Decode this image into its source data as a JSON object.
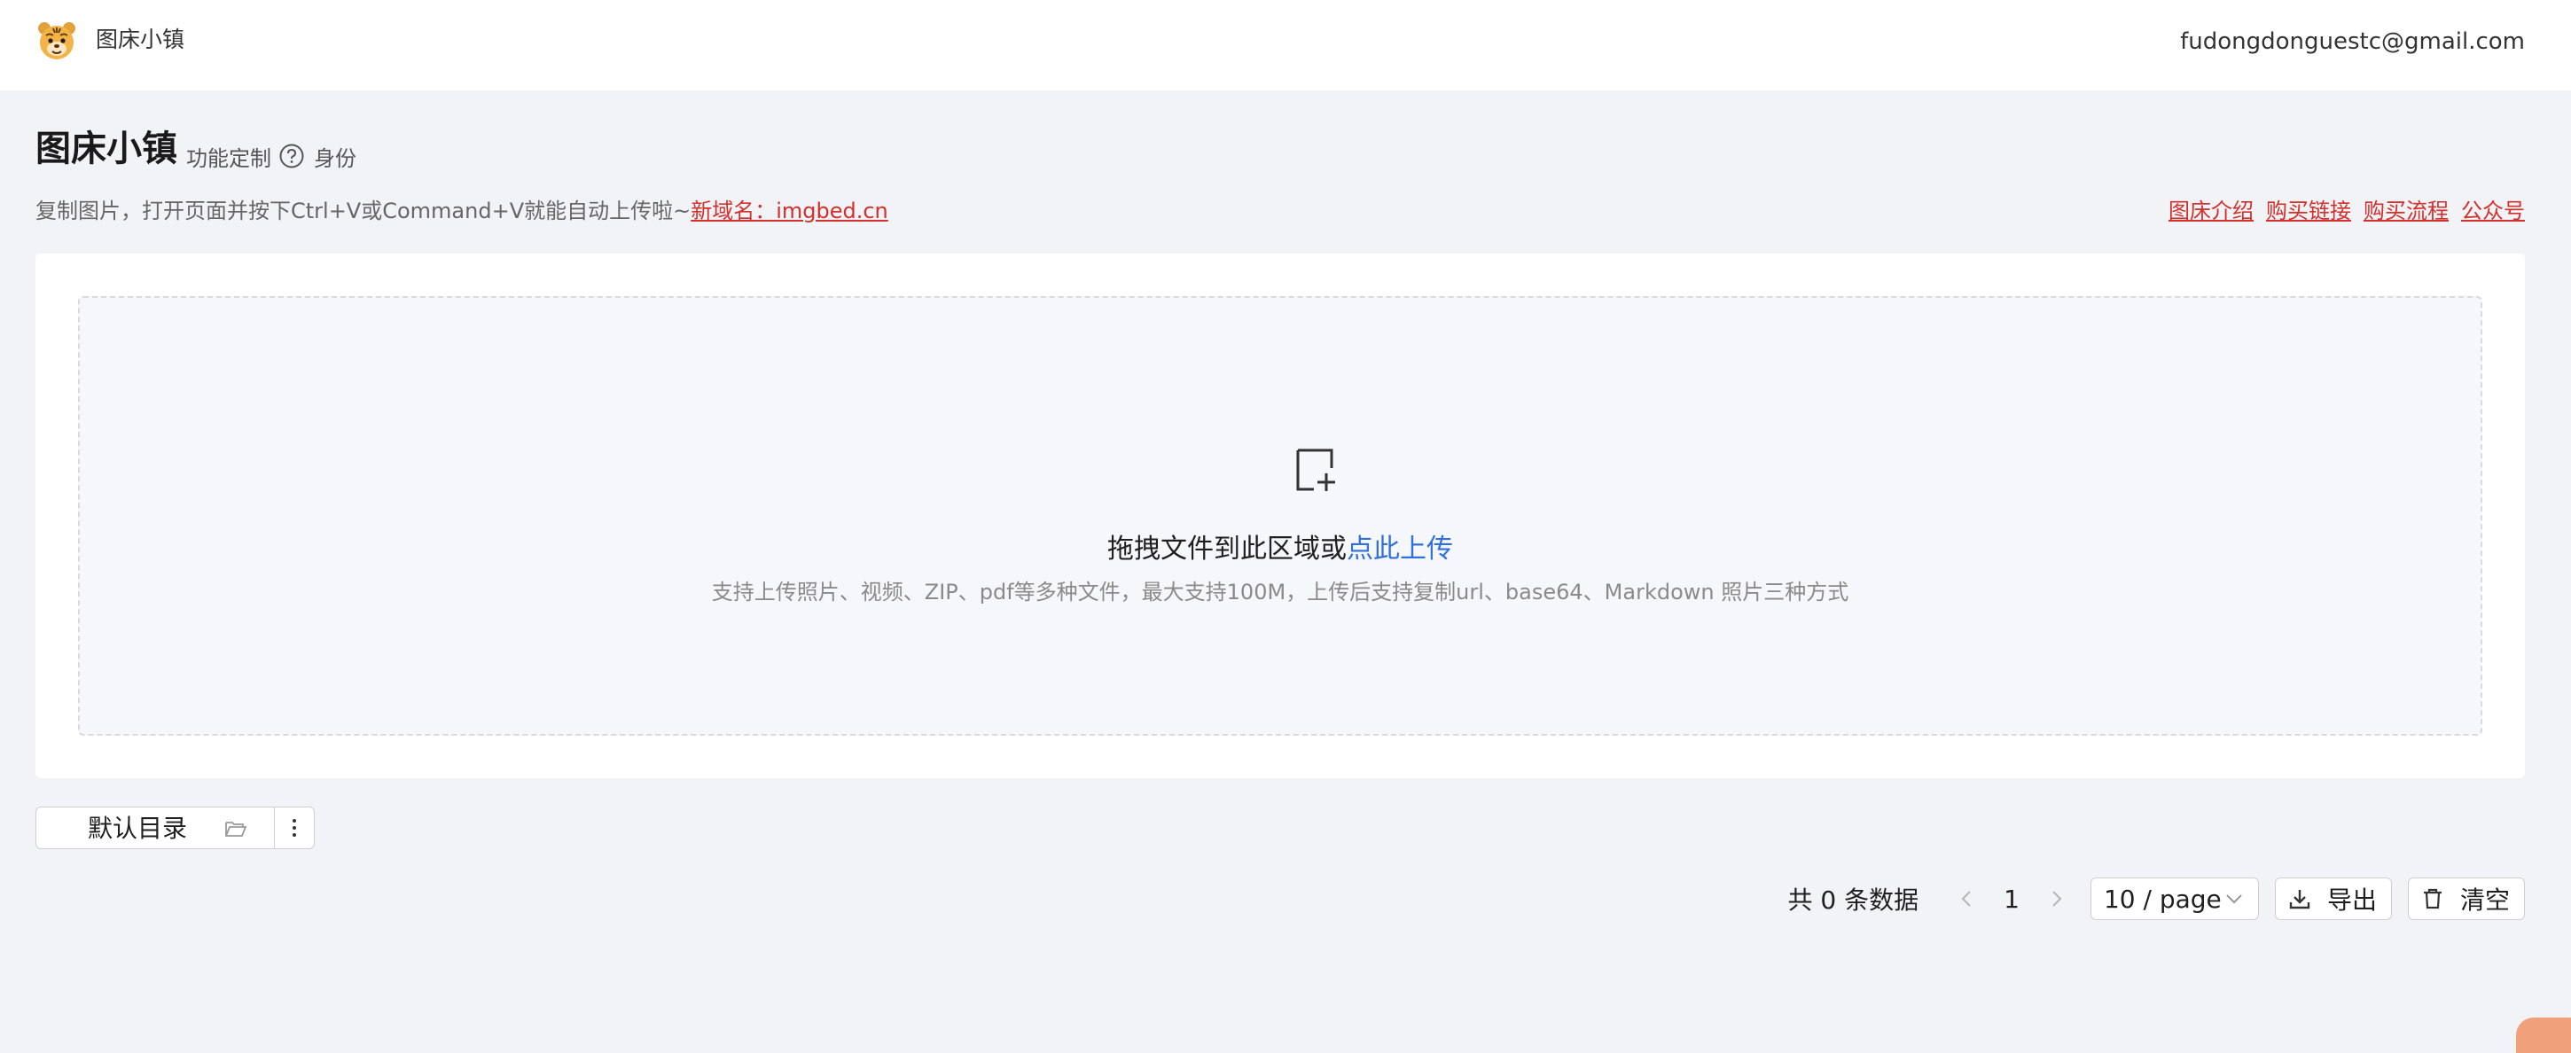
{
  "header": {
    "brand": "图床小镇",
    "user_email": "fudongdonguestc@gmail.com"
  },
  "page": {
    "title": "图床小镇",
    "custom_label": "功能定制",
    "identity_label": "身份",
    "subtitle_text": "复制图片，打开页面并按下Ctrl+V或Command+V就能自动上传啦~",
    "subtitle_link": "新域名：imgbed.cn",
    "links": [
      "图床介绍",
      "购买链接",
      "购买流程",
      "公众号"
    ]
  },
  "upload": {
    "prompt": "拖拽文件到此区域或",
    "prompt_link": "点此上传",
    "hint": "支持上传照片、视频、ZIP、pdf等多种文件，最大支持100M，上传后支持复制url、base64、Markdown 照片三种方式"
  },
  "directory": {
    "selected": "默认目录"
  },
  "pagination": {
    "total": "共 0 条数据",
    "current_page": "1",
    "page_size": "10 / page"
  },
  "actions": {
    "export_label": "导出",
    "clear_label": "清空"
  },
  "colors": {
    "accent_link": "#2f6fde",
    "red_link": "#d4302b",
    "background": "#f2f3f7"
  }
}
